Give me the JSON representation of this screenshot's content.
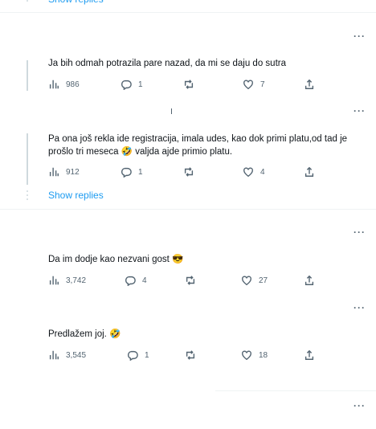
{
  "replies_link": "Show replies",
  "more_label": "···",
  "tweets": [
    {
      "text": "Ja bih odmah potrazila pare nazad, da mi se daju do sutra",
      "views": "986",
      "replies": "1",
      "retweets": "",
      "likes": "7"
    },
    {
      "text": "Pa ona još rekla ide registracija, imala udes, kao dok primi platu,od tad je prošlo tri meseca 🤣 valjda ajde primio platu.",
      "views": "912",
      "replies": "1",
      "retweets": "",
      "likes": "4"
    },
    {
      "text": "Da im dodje kao nezvani gost 😎",
      "views": "3,742",
      "replies": "4",
      "retweets": "",
      "likes": "27"
    },
    {
      "text": "Predlažem joj. 🤣",
      "views": "3,545",
      "replies": "1",
      "retweets": "",
      "likes": "18"
    }
  ],
  "icons": {
    "views": "views-chart-icon",
    "reply": "reply-bubble-icon",
    "retweet": "retweet-icon",
    "like": "heart-icon",
    "share": "share-upload-icon",
    "more": "more-dots-icon"
  },
  "colors": {
    "link": "#1d9bf0",
    "muted": "#536471",
    "line": "#cfd9de",
    "divider": "#eff3f4"
  }
}
